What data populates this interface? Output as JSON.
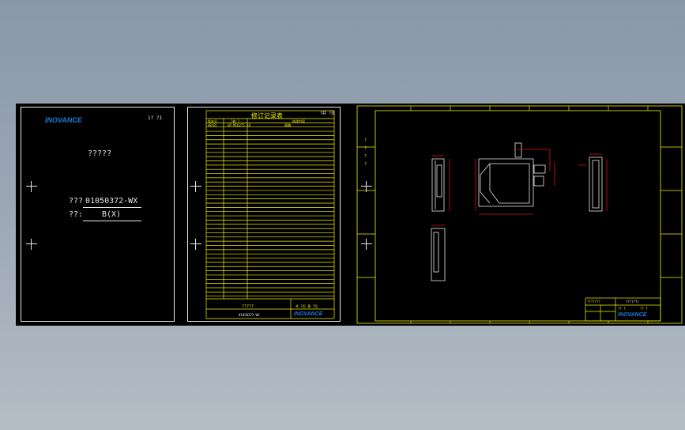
{
  "sheet1": {
    "logo": "INOVANCE",
    "page_mark": "1?  ?1",
    "title": "?????",
    "code_label": "???",
    "code_value": "01050372-WX",
    "version_label": "??:",
    "version_value": "B(X)"
  },
  "sheet2": {
    "title": "修订记录表",
    "corner_label": "?共 ?页",
    "header_cols": [
      "版本号",
      "?修 ?",
      "修改内容"
    ],
    "first_row": [
      "A0(B)",
      "GP-MCU275-10",
      "原稿"
    ],
    "footer_title": "?????",
    "footer_page": "共 ?页    第 ?页",
    "footer_code": "01050372-WX",
    "logo": "INOVANCE"
  },
  "sheet3": {
    "side_labels": [
      "?",
      "?",
      "?",
      "?"
    ],
    "title_block_left": "???????",
    "title_block_right": "???(??)",
    "title_block_scale": "?? ?",
    "title_block_sheet": "?? ?",
    "logo": "INOVANCE"
  },
  "colors": {
    "background_top": "#8a97a8",
    "canvas": "#000000",
    "border": "#e8e8e8",
    "frame": "#f0f000",
    "dimension": "#e01010",
    "brand": "#1e7bd8"
  }
}
